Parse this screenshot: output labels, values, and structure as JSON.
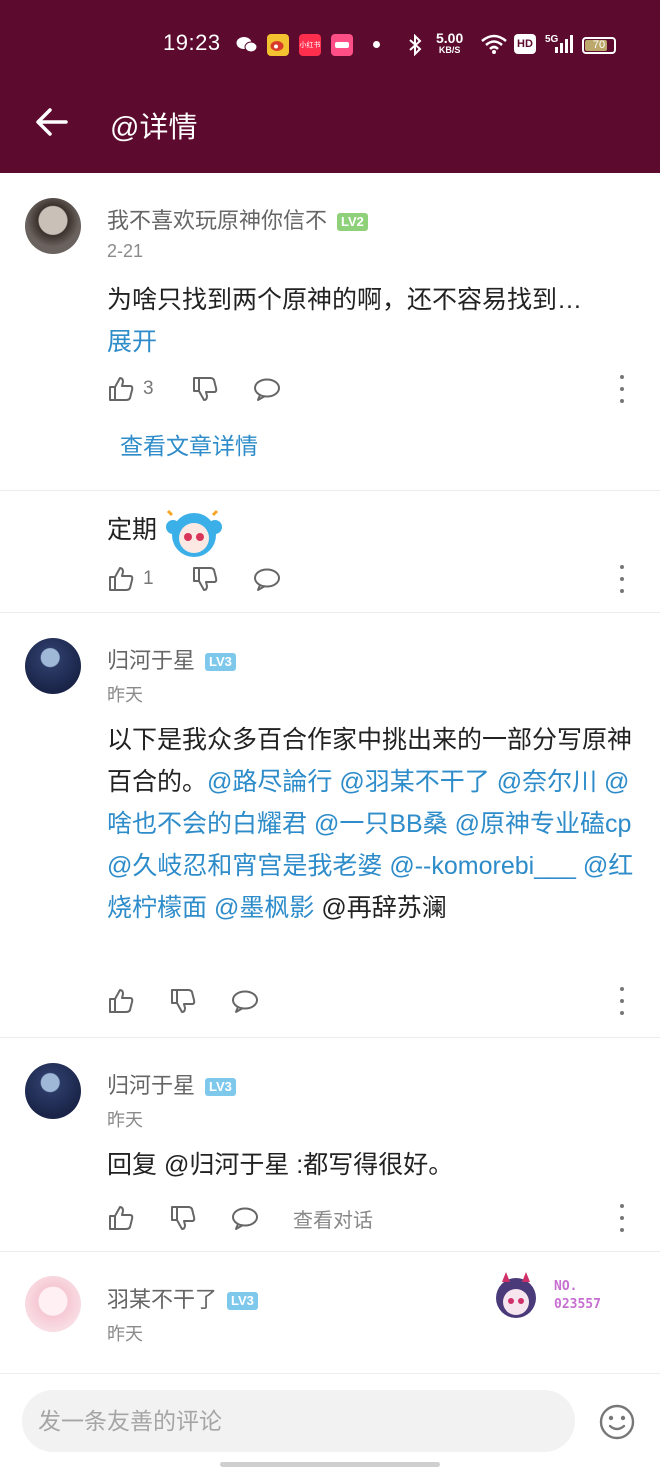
{
  "status_bar": {
    "time": "19:23",
    "speed_value": "5.00",
    "speed_unit": "KB/S",
    "hd_label": "HD",
    "network_label": "5G",
    "battery": "70",
    "app_icons": [
      "wechat-icon",
      "weibo-icon",
      "xiaohongshu-icon",
      "app-icon",
      "dot-icon"
    ],
    "xhs_label": "小红书"
  },
  "header": {
    "title": "@详情"
  },
  "comments": [
    {
      "username": "我不喜欢玩原神你信不",
      "level": "LV2",
      "level_color": "#8fd07a",
      "date": "2-21",
      "text": "为啥只找到两个原神的啊，还不容易找到…",
      "expand": "展开",
      "likes": "3",
      "article_link": "查看文章详情"
    },
    {
      "text": "定期",
      "likes": "1"
    },
    {
      "username": "归河于星",
      "level": "LV3",
      "level_color": "#7ec8ec",
      "date": "昨天",
      "text_lead": "以下是我众多百合作家中挑出来的一部分写原神百合的。",
      "mentions": [
        "@路尽論行",
        "@羽某不干了",
        "@奈尔川",
        "@啥也不会的白耀君",
        "@一只BB桑",
        "@原神专业磕cp",
        "@久岐忍和宵宫是我老婆",
        "@--komorebi___",
        "@红烧柠檬面",
        "@墨枫影"
      ],
      "tail": "@再辞苏澜"
    },
    {
      "username": "归河于星",
      "level": "LV3",
      "level_color": "#7ec8ec",
      "date": "昨天",
      "text": "回复 @归河于星 :都写得很好。",
      "view_conversation": "查看对话"
    },
    {
      "username": "羽某不干了",
      "level": "LV3",
      "level_color": "#7ec8ec",
      "date": "昨天",
      "badge_no": "NO.",
      "badge_id": "023557"
    }
  ],
  "bottom": {
    "placeholder": "发一条友善的评论"
  },
  "colors": {
    "header_bg": "#5c0a2e",
    "mention": "#2d8cc9"
  }
}
